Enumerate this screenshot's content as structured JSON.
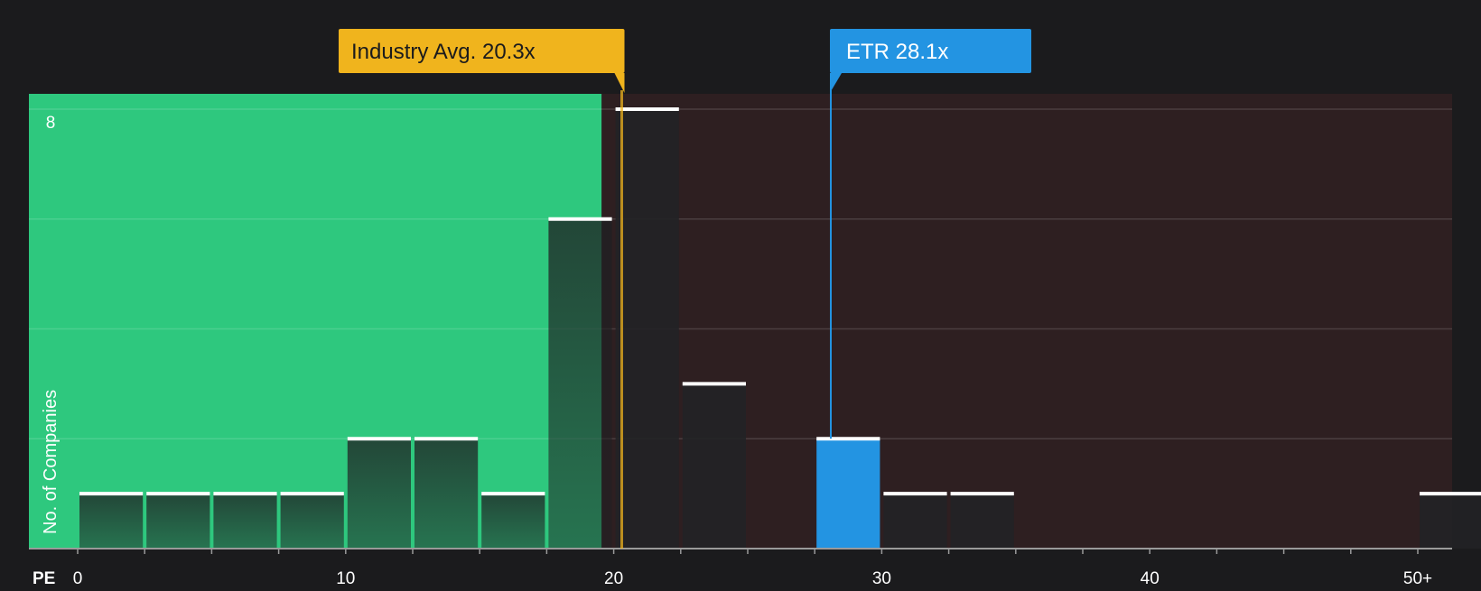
{
  "chart_data": {
    "type": "bar",
    "xlabel": "PE",
    "ylabel": "No. of Companies",
    "x_ticks": [
      0,
      10,
      20,
      30,
      40,
      50
    ],
    "x_tick_labels": [
      "0",
      "10",
      "20",
      "30",
      "40",
      "50+"
    ],
    "xlim": [
      0,
      51
    ],
    "ylim": [
      0,
      8.3
    ],
    "y_ticks_labeled": [
      {
        "value": 8,
        "label": "8"
      }
    ],
    "bin_width": 2.5,
    "bins": [
      {
        "start": 0,
        "end": 2.5,
        "count": 1
      },
      {
        "start": 2.5,
        "end": 5,
        "count": 1
      },
      {
        "start": 5,
        "end": 7.5,
        "count": 1
      },
      {
        "start": 7.5,
        "end": 10,
        "count": 1
      },
      {
        "start": 10,
        "end": 12.5,
        "count": 2
      },
      {
        "start": 12.5,
        "end": 15,
        "count": 2
      },
      {
        "start": 15,
        "end": 17.5,
        "count": 1
      },
      {
        "start": 17.5,
        "end": 20,
        "count": 6
      },
      {
        "start": 20,
        "end": 22.5,
        "count": 8
      },
      {
        "start": 22.5,
        "end": 25,
        "count": 3
      },
      {
        "start": 27.5,
        "end": 30,
        "count": 2,
        "highlight": true
      },
      {
        "start": 30,
        "end": 32.5,
        "count": 1
      },
      {
        "start": 32.5,
        "end": 35,
        "count": 1
      },
      {
        "start": 50,
        "end": 52.5,
        "count": 1
      }
    ],
    "grid": true,
    "annotations": [
      {
        "label": "Industry Avg. 20.3x",
        "value": 20.3,
        "color": "#f0b41d"
      },
      {
        "label": "ETR 28.1x",
        "value": 28.1,
        "color": "#2394e2"
      }
    ],
    "colors": {
      "background": "#1b1b1d",
      "undervalued_region": "#2ec87e",
      "overvalued_region": "#2e1f21",
      "bar": "#222226",
      "highlight_bar": "#2394e2",
      "industry_marker": "#f0b41d",
      "company_marker": "#2394e2",
      "text": "#ffffff"
    }
  }
}
